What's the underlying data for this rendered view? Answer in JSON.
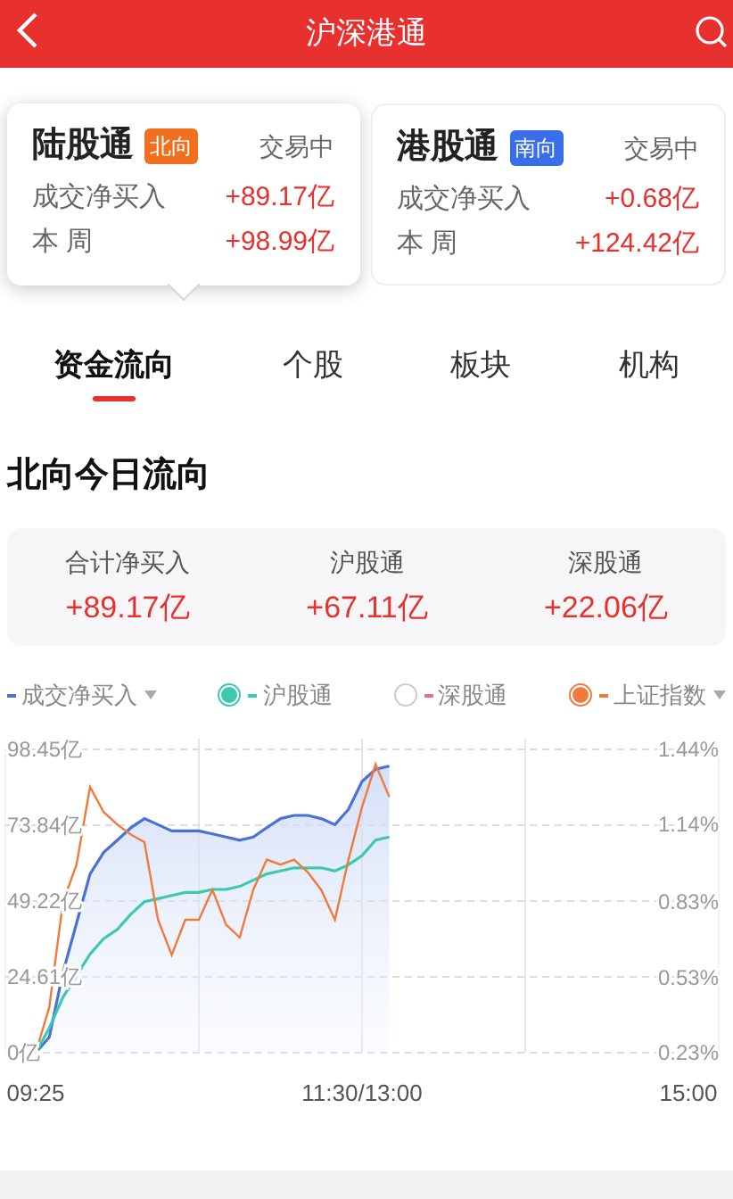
{
  "header": {
    "title": "沪深港通"
  },
  "cards": [
    {
      "name": "陆股通",
      "direction": "北向",
      "color": "#f07020",
      "status": "交易中",
      "selected": true,
      "rows": [
        {
          "label": "成交净买入",
          "value": "+89.17亿"
        },
        {
          "label": "本 周",
          "value": "+98.99亿"
        }
      ]
    },
    {
      "name": "港股通",
      "direction": "南向",
      "color": "#3a6ee8",
      "status": "交易中",
      "selected": false,
      "rows": [
        {
          "label": "成交净买入",
          "value": "+0.68亿"
        },
        {
          "label": "本 周",
          "value": "+124.42亿"
        }
      ]
    }
  ],
  "tabs": [
    {
      "label": "资金流向",
      "selected": true
    },
    {
      "label": "个股",
      "selected": false
    },
    {
      "label": "板块",
      "selected": false
    },
    {
      "label": "机构",
      "selected": false
    }
  ],
  "section_title": "北向今日流向",
  "summary": [
    {
      "label": "合计净买入",
      "value": "+89.17亿"
    },
    {
      "label": "沪股通",
      "value": "+67.11亿"
    },
    {
      "label": "深股通",
      "value": "+22.06亿"
    }
  ],
  "legend": [
    {
      "kind": "plain",
      "dropdown": true
    },
    {
      "kind": "radio",
      "selected": true,
      "dropdown": false
    },
    {
      "kind": "radio",
      "selected": false,
      "dropdown": false
    },
    {
      "kind": "radio",
      "selected": true,
      "dropdown": true
    }
  ],
  "chart_data": {
    "type": "line",
    "categories": [
      "09:25",
      null,
      null,
      null,
      null,
      null,
      null,
      null,
      null,
      null,
      null,
      null,
      null,
      null,
      null,
      null,
      null,
      null,
      null,
      null,
      null,
      null,
      null,
      null,
      "11:30/13:00",
      null,
      null,
      null,
      null,
      null,
      null,
      null,
      null,
      null,
      null,
      null,
      null,
      null,
      null,
      null,
      null,
      null,
      null,
      null,
      null,
      null,
      null,
      null,
      "15:00"
    ],
    "series": [
      {
        "name": "成交净买入",
        "color": "#4a72d6",
        "values": [
          0,
          5,
          26,
          42,
          58,
          65,
          69,
          73,
          76,
          74,
          72,
          72,
          72,
          71,
          70,
          69,
          70,
          73,
          76,
          77,
          77,
          76,
          74,
          79,
          88,
          92,
          93,
          null,
          null,
          null,
          null,
          null,
          null,
          null,
          null,
          null,
          null,
          null,
          null,
          null,
          null,
          null,
          null,
          null,
          null,
          null,
          null,
          null,
          null
        ]
      },
      {
        "name": "沪股通",
        "color": "#3cc9b0",
        "values": [
          0,
          8,
          18,
          25,
          32,
          37,
          40,
          45,
          49,
          50,
          51,
          52,
          52,
          53,
          53,
          54,
          56,
          58,
          59,
          60,
          60,
          60,
          59,
          61,
          64,
          69,
          70,
          null,
          null,
          null,
          null,
          null,
          null,
          null,
          null,
          null,
          null,
          null,
          null,
          null,
          null,
          null,
          null,
          null,
          null,
          null,
          null,
          null,
          null
        ]
      },
      {
        "name": "深股通",
        "color": "#e8708a",
        "values": [
          null,
          null,
          null,
          null,
          null,
          null,
          null,
          null,
          null,
          null,
          null,
          null,
          null,
          null,
          null,
          null,
          null,
          null,
          null,
          null,
          null,
          null,
          null,
          null,
          null,
          null,
          null,
          null,
          null,
          null,
          null,
          null,
          null,
          null,
          null,
          null,
          null,
          null,
          null,
          null,
          null,
          null,
          null,
          null,
          null,
          null,
          null,
          null,
          null
        ]
      },
      {
        "name": "上证指数",
        "color": "#f07a3c",
        "axis": "y2",
        "values": [
          0.23,
          0.41,
          0.83,
          0.98,
          1.29,
          1.19,
          1.14,
          1.1,
          1.07,
          0.76,
          0.62,
          0.76,
          0.76,
          0.88,
          0.74,
          0.69,
          0.88,
          1.0,
          0.98,
          1.0,
          0.95,
          0.88,
          0.76,
          1.0,
          1.21,
          1.38,
          1.25,
          null,
          null,
          null,
          null,
          null,
          null,
          null,
          null,
          null,
          null,
          null,
          null,
          null,
          null,
          null,
          null,
          null,
          null,
          null,
          null,
          null,
          null
        ]
      }
    ],
    "ylim": [
      0,
      98.45
    ],
    "grid": true,
    "yticks": [
      {
        "value": 0,
        "label": "0亿"
      },
      {
        "value": 24.61,
        "label": "24.61亿"
      },
      {
        "value": 49.22,
        "label": "49.22亿"
      },
      {
        "value": 73.84,
        "label": "73.84亿"
      },
      {
        "value": 98.45,
        "label": "98.45亿"
      }
    ],
    "y2lim": [
      0.23,
      1.44
    ],
    "y2ticks": [
      {
        "value": 1.44,
        "label": "1.44%"
      },
      {
        "value": 1.14,
        "label": "1.14%"
      },
      {
        "value": 0.83,
        "label": "0.83%"
      },
      {
        "value": 0.53,
        "label": "0.53%"
      },
      {
        "value": 0.23,
        "label": "0.23%"
      }
    ]
  }
}
